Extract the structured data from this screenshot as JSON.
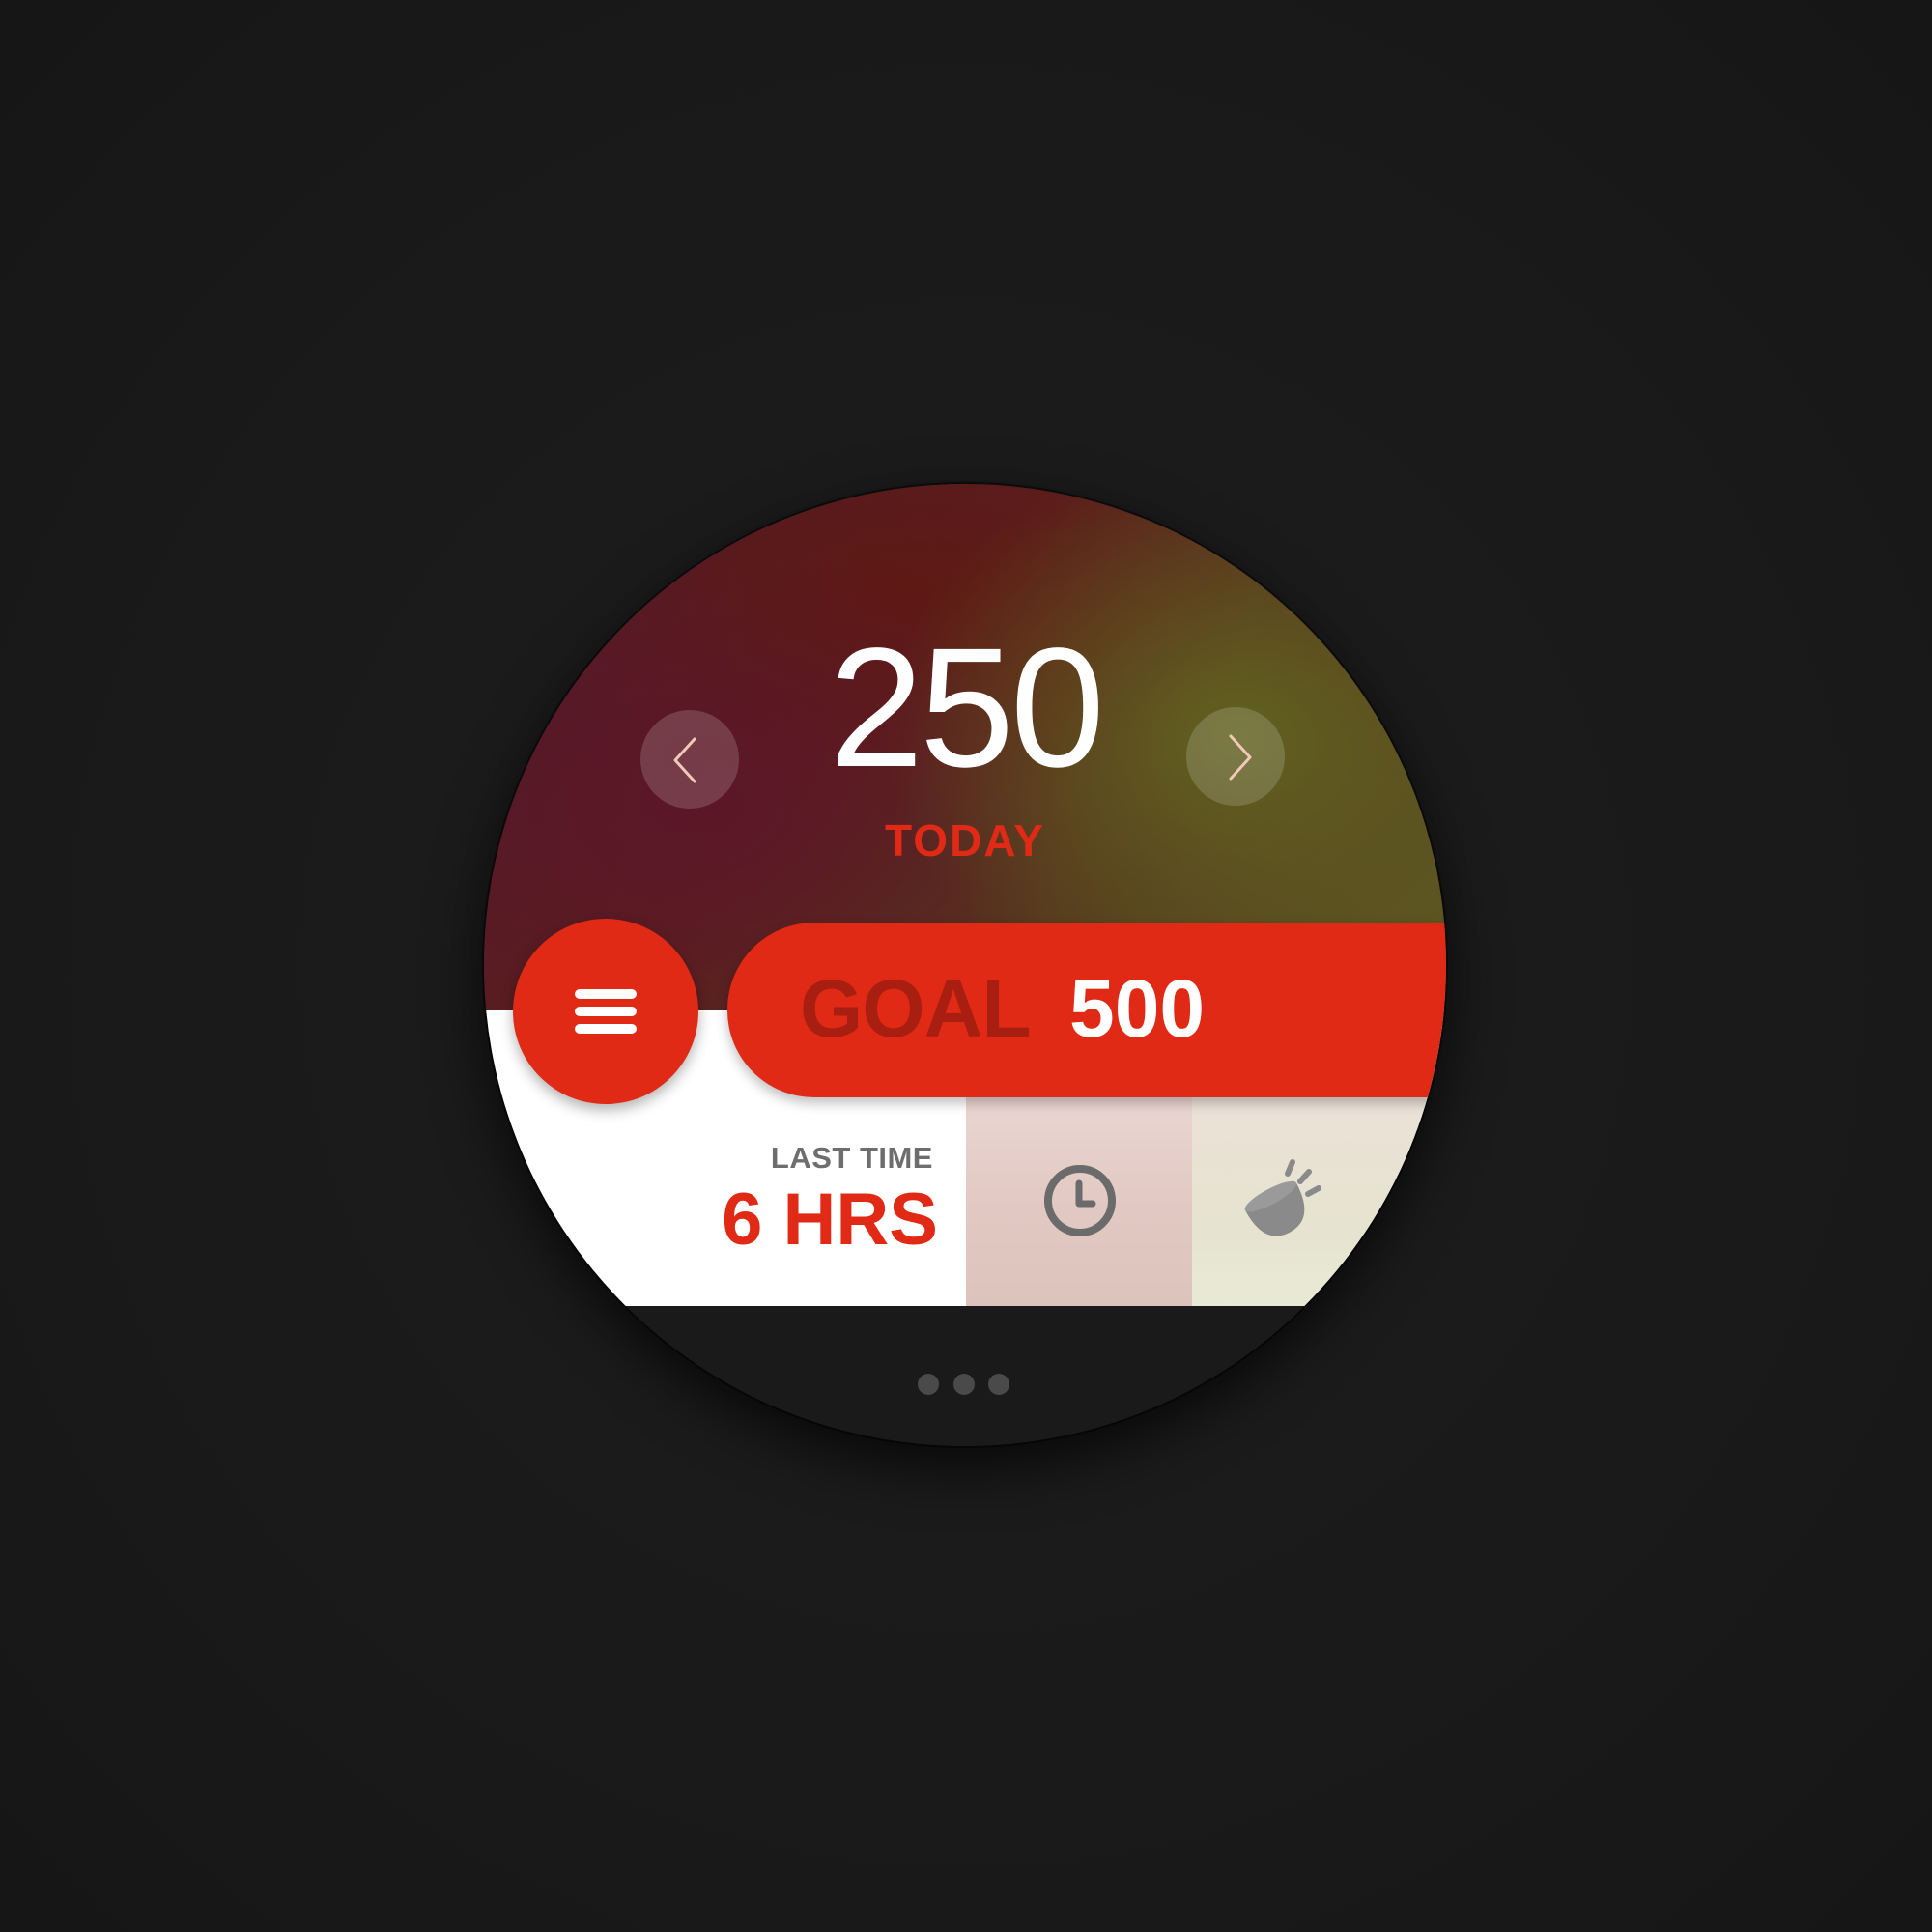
{
  "counter": {
    "value": "250",
    "period_label": "TODAY",
    "prev_icon": "chevron-left-icon",
    "next_icon": "chevron-right-icon"
  },
  "goal": {
    "label": "GOAL",
    "value": "500"
  },
  "menu": {
    "icon": "hamburger-menu-icon"
  },
  "last_time": {
    "label": "LAST TIME",
    "value": "6 HRS"
  },
  "tiles": [
    {
      "icon": "clock-icon"
    },
    {
      "icon": "bowl-icon"
    }
  ],
  "pagination": {
    "total": 3
  },
  "colors": {
    "accent": "#e02a15",
    "goal_label": "#a81e10",
    "muted_text": "#6e6e6e",
    "background": "#1b1b1b"
  }
}
